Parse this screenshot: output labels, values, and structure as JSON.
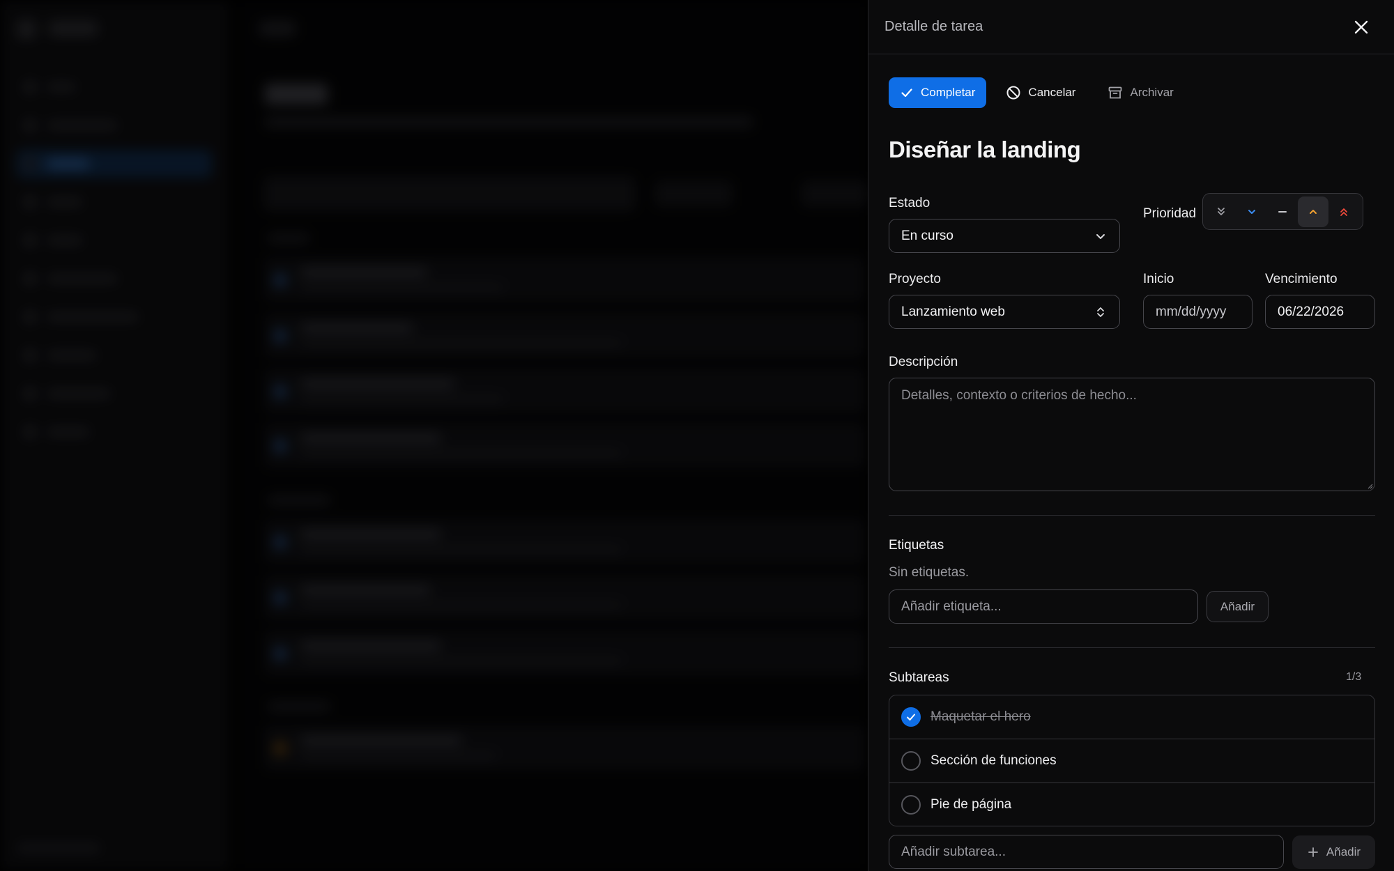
{
  "drawer": {
    "title": "Detalle de tarea",
    "actions": {
      "complete_label": "Completar",
      "cancel_label": "Cancelar",
      "archive_label": "Archivar"
    },
    "task_title": "Diseñar la landing",
    "status": {
      "label": "Estado",
      "value": "En curso"
    },
    "priority": {
      "label": "Prioridad",
      "options": [
        "lowest",
        "low",
        "medium",
        "high",
        "highest"
      ],
      "selected": "high",
      "colors": {
        "lowest": "#a0a0a6",
        "low": "#3b8cf0",
        "medium": "#c8c8cc",
        "high": "#f0a030",
        "highest": "#f04a3c"
      }
    },
    "project": {
      "label": "Proyecto",
      "value": "Lanzamiento web"
    },
    "start": {
      "label": "Inicio",
      "value": "mm/dd/yyyy"
    },
    "due": {
      "label": "Vencimiento",
      "value": "06/22/2026"
    },
    "description": {
      "label": "Descripción",
      "placeholder": "Detalles, contexto o criterios de hecho..."
    },
    "tags": {
      "label": "Etiquetas",
      "empty_text": "Sin etiquetas.",
      "input_placeholder": "Añadir etiqueta...",
      "add_label": "Añadir"
    },
    "subtasks": {
      "label": "Subtareas",
      "count": "1/3",
      "items": [
        {
          "text": "Maquetar el hero",
          "done": true
        },
        {
          "text": "Sección de funciones",
          "done": false
        },
        {
          "text": "Pie de página",
          "done": false
        }
      ],
      "input_placeholder": "Añadir subtarea...",
      "add_label": "Añadir"
    }
  },
  "theme": {
    "accent": "#0f6ee6"
  }
}
